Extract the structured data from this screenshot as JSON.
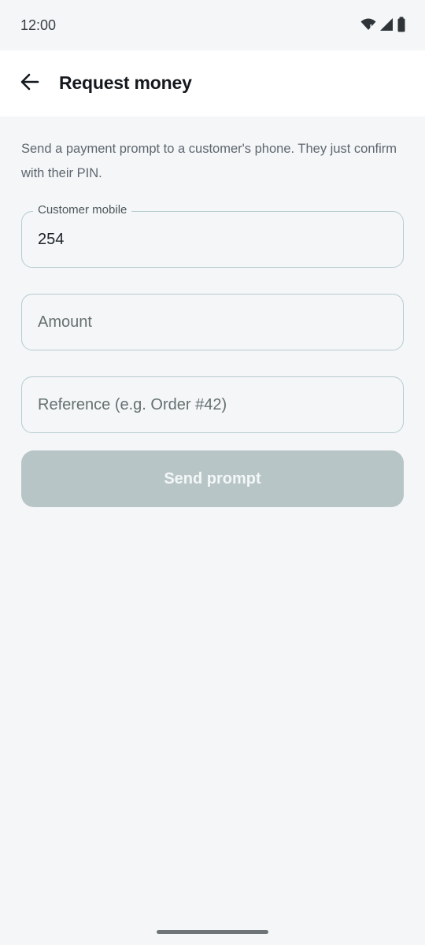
{
  "status_bar": {
    "time": "12:00",
    "icons": [
      "wifi-icon",
      "cell-signal-icon",
      "battery-icon"
    ]
  },
  "app_bar": {
    "back_icon": "arrow-left-icon",
    "title": "Request money"
  },
  "description": "Send a payment prompt to a customer's phone. They just confirm with their PIN.",
  "form": {
    "customer_mobile": {
      "label": "Customer mobile",
      "value": "254"
    },
    "amount": {
      "placeholder": "Amount",
      "value": ""
    },
    "reference": {
      "placeholder": "Reference (e.g. Order #42)",
      "value": ""
    },
    "submit_label": "Send prompt",
    "submit_enabled": false
  },
  "colors": {
    "background": "#f4f6f8",
    "app_bar": "#ffffff",
    "field_border": "#b7ccd0",
    "button_disabled": "#b7c5c6",
    "title_text": "#15191d",
    "secondary_text": "#5e676f"
  }
}
